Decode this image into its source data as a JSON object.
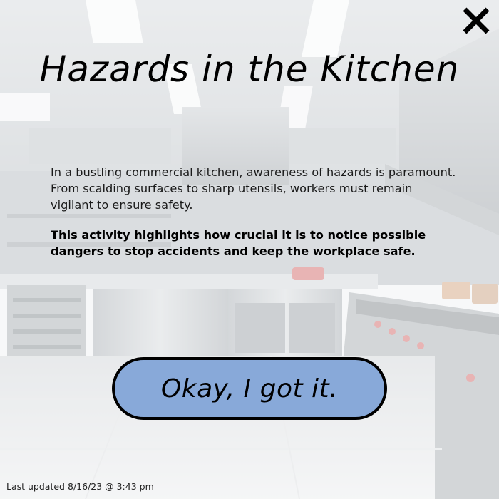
{
  "dialog": {
    "title": "Hazards in the Kitchen",
    "paragraphs": [
      "In a bustling commercial kitchen, awareness of hazards is paramount. From scalding surfaces to sharp utensils, workers must remain vigilant to ensure safety.",
      "This activity highlights how crucial it is to notice possible dangers to stop accidents and keep the workplace safe."
    ],
    "confirm_label": "Okay, I got it.",
    "close_icon": "close-icon"
  },
  "footer": {
    "last_updated": "Last updated 8/16/23 @ 3:43 pm"
  },
  "colors": {
    "button_fill": "#88a9d9",
    "button_border": "#000000",
    "text": "#000000"
  }
}
